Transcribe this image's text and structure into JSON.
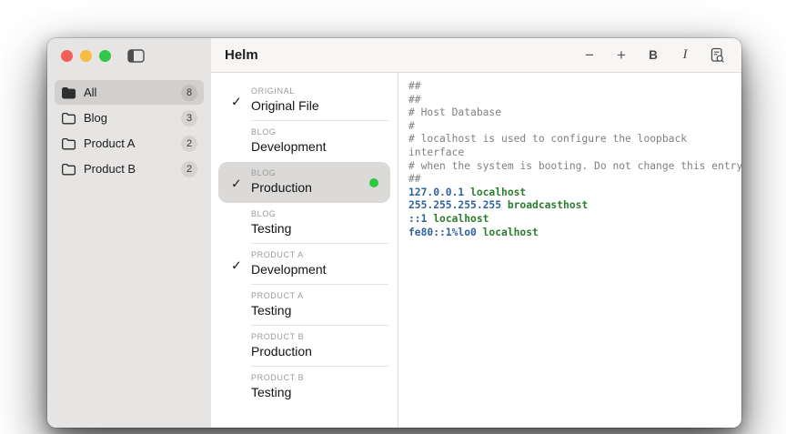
{
  "window": {
    "title": "Helm"
  },
  "traffic_lights": {
    "close_color": "#f25f58",
    "minimize_color": "#f6bd3f",
    "zoom_color": "#31c748"
  },
  "sidebar": {
    "items": [
      {
        "label": "All",
        "count": "8",
        "selected": true,
        "icon": "folder-filled-icon"
      },
      {
        "label": "Blog",
        "count": "3",
        "selected": false,
        "icon": "folder-outline-icon"
      },
      {
        "label": "Product A",
        "count": "2",
        "selected": false,
        "icon": "folder-outline-icon"
      },
      {
        "label": "Product B",
        "count": "2",
        "selected": false,
        "icon": "folder-outline-icon"
      }
    ]
  },
  "toolbar": {
    "buttons": [
      {
        "name": "decrease-font",
        "glyph": "−"
      },
      {
        "name": "increase-font",
        "glyph": "+"
      },
      {
        "name": "bold",
        "glyph": "B"
      },
      {
        "name": "italic",
        "glyph": "I"
      },
      {
        "name": "preview-search",
        "glyph": ""
      }
    ]
  },
  "profiles": {
    "items": [
      {
        "category": "ORIGINAL",
        "title": "Original File",
        "checked": true,
        "selected": false,
        "active_dot": false
      },
      {
        "category": "BLOG",
        "title": "Development",
        "checked": false,
        "selected": false,
        "active_dot": false
      },
      {
        "category": "BLOG",
        "title": "Production",
        "checked": true,
        "selected": true,
        "active_dot": true
      },
      {
        "category": "BLOG",
        "title": "Testing",
        "checked": false,
        "selected": false,
        "active_dot": false
      },
      {
        "category": "PRODUCT A",
        "title": "Development",
        "checked": true,
        "selected": false,
        "active_dot": false
      },
      {
        "category": "PRODUCT A",
        "title": "Testing",
        "checked": false,
        "selected": false,
        "active_dot": false
      },
      {
        "category": "PRODUCT B",
        "title": "Production",
        "checked": false,
        "selected": false,
        "active_dot": false
      },
      {
        "category": "PRODUCT B",
        "title": "Testing",
        "checked": false,
        "selected": false,
        "active_dot": false
      }
    ],
    "active_dot_color": "#2bc840",
    "check_glyph": "✓"
  },
  "editor": {
    "colors": {
      "comment": "#808080",
      "ip": "#31639f",
      "host": "#2d7d2f"
    },
    "lines": [
      [
        {
          "t": "##",
          "c": "comment"
        }
      ],
      [
        {
          "t": "##",
          "c": "comment"
        }
      ],
      [
        {
          "t": "# Host Database",
          "c": "comment"
        }
      ],
      [
        {
          "t": "#",
          "c": "comment"
        }
      ],
      [
        {
          "t": "# localhost is used to configure the loopback",
          "c": "comment"
        }
      ],
      [
        {
          "t": "interface",
          "c": "comment"
        }
      ],
      [
        {
          "t": "# when the system is booting. Do not change this entry",
          "c": "comment"
        }
      ],
      [
        {
          "t": "##",
          "c": "comment"
        }
      ],
      [
        {
          "t": "127.0.0.1 ",
          "c": "ip"
        },
        {
          "t": "localhost",
          "c": "host"
        }
      ],
      [
        {
          "t": "255.255.255.255 ",
          "c": "ip"
        },
        {
          "t": "broadcasthost",
          "c": "host"
        }
      ],
      [
        {
          "t": "::1 ",
          "c": "ip"
        },
        {
          "t": "localhost",
          "c": "host"
        }
      ],
      [
        {
          "t": "fe80::1%lo0 ",
          "c": "ip"
        },
        {
          "t": "localhost",
          "c": "host"
        }
      ]
    ]
  }
}
